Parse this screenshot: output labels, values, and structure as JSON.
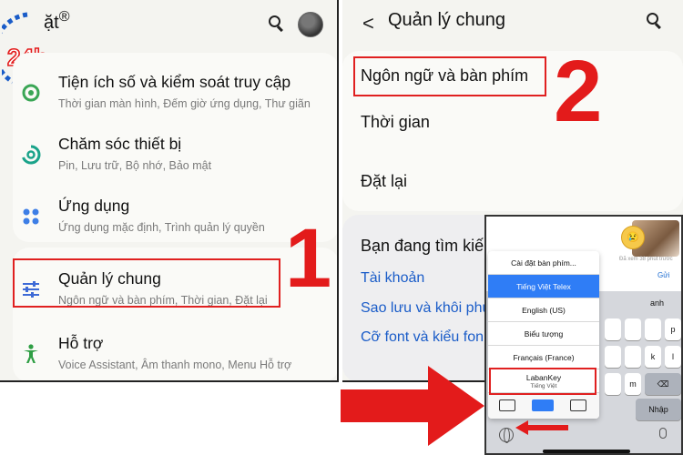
{
  "left_panel": {
    "title": "ặt",
    "registered_mark": "®",
    "logo_text": "24h",
    "step_number": "1",
    "items": [
      {
        "title": "Tiện ích số và kiểm soát truy cập",
        "subtitle": "Thời gian màn hình, Đếm giờ ứng dụng, Thư giãn",
        "icon": "digital-wellbeing-icon",
        "color": "#3aa655"
      },
      {
        "title": "Chăm sóc thiết bị",
        "subtitle": "Pin, Lưu trữ, Bộ nhớ, Bảo mật",
        "icon": "device-care-icon",
        "color": "#1aa38a"
      },
      {
        "title": "Ứng dụng",
        "subtitle": "Ứng dụng mặc định, Trình quản lý quyền",
        "icon": "apps-icon",
        "color": "#3d7ee6"
      },
      {
        "title": "Quản lý chung",
        "subtitle": "Ngôn ngữ và bàn phím, Thời gian, Đặt lại",
        "icon": "sliders-icon",
        "color": "#3d6ad6"
      },
      {
        "title": "Hỗ trợ",
        "subtitle": "Voice Assistant, Âm thanh mono, Menu Hỗ trợ",
        "icon": "accessibility-icon",
        "color": "#2e9e44"
      }
    ]
  },
  "middle_panel": {
    "back": "<",
    "title": "Quản lý chung",
    "step_number": "2",
    "items": [
      "Ngôn ngữ và bàn phím",
      "Thời gian",
      "Đặt lại"
    ],
    "search_heading": "Bạn đang tìm kiế",
    "links": [
      "Tài khoản",
      "Sao lưu và khôi phụ",
      "Cỡ font và kiểu fon"
    ]
  },
  "keyboard_panel": {
    "time_text": "Đã xem 38 phút trước",
    "send_label": "Gửi",
    "suggestion": "anh",
    "keys_row1": [
      "p"
    ],
    "keys_row2": [
      "k",
      "l"
    ],
    "keys_row3": [
      "m"
    ],
    "return_label": "Nhập",
    "menu_items": [
      "Cài đặt bàn phím...",
      "Tiếng Việt Telex",
      "English (US)",
      "Biểu tượng",
      "Français (France)"
    ],
    "labankey": {
      "name": "LabanKey",
      "sub": "Tiếng Việt"
    }
  },
  "colors": {
    "accent_red": "#e31b1b",
    "link_blue": "#1a5cc8",
    "selected_blue": "#2f7df6"
  }
}
